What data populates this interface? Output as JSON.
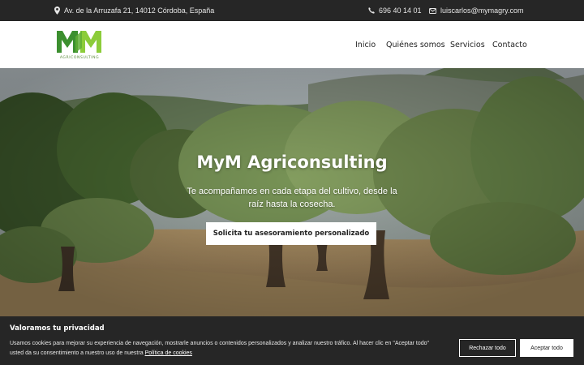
{
  "topbar": {
    "address": "Av. de la Arruzafa 21, 14012 Córdoba, España",
    "phone": "696 40 14 01",
    "email": "luiscarlos@mymagry.com",
    "icons": {
      "address": "map-pin-icon",
      "phone": "phone-icon",
      "email": "envelope-icon"
    }
  },
  "header": {
    "logo_text": "AGRICONSULTING",
    "logo_colors": {
      "dark": "#3c8f2f",
      "light": "#8ccc3a"
    },
    "nav": [
      {
        "label": "Inicio"
      },
      {
        "label": "Quiénes somos"
      },
      {
        "label": "Servicios"
      },
      {
        "label": "Contacto"
      }
    ]
  },
  "hero": {
    "title": "MyM Agriconsulting",
    "subtitle": "Te acompañamos en cada etapa del cultivo, desde la raíz hasta la cosecha.",
    "cta_label": "Solicita tu asesoramiento personalizado"
  },
  "cookie": {
    "title": "Valoramos tu privacidad",
    "text": "Usamos cookies para mejorar su experiencia de navegación, mostrarle anuncios o contenidos personalizados y analizar nuestro tráfico. Al hacer clic en \"Aceptar todo\" usted da su consentimiento a nuestro uso de nuestra ",
    "link_label": "Política de cookies",
    "reject_label": "Rechazar todo",
    "accept_label": "Aceptar todo"
  },
  "colors": {
    "topbar": "#262626",
    "banner": "#262626",
    "foliage": "#5f7f3a"
  }
}
